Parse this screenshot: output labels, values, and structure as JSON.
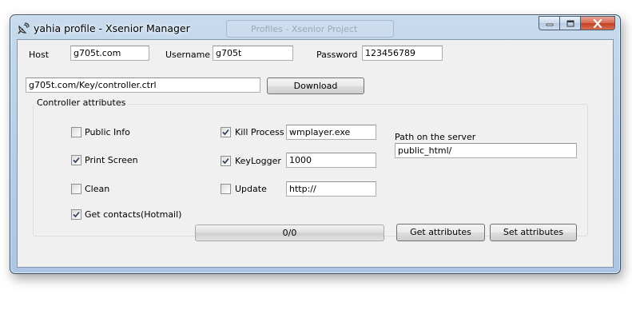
{
  "window": {
    "title": "yahia profile - Xsenior Manager",
    "background_window_title": "Profiles - Xsenior Project"
  },
  "connection": {
    "host_label": "Host",
    "host_value": "g705t.com",
    "username_label": "Username",
    "username_value": "g705t",
    "password_label": "Password",
    "password_value": "123456789"
  },
  "download": {
    "path_value": "g705t.com/Key/controller.ctrl",
    "button_label": "Download"
  },
  "attributes": {
    "group_title": "Controller attributes",
    "public_info": {
      "label": "Public Info",
      "checked": false
    },
    "print_screen": {
      "label": "Print Screen",
      "checked": true
    },
    "clean": {
      "label": "Clean",
      "checked": false
    },
    "get_contacts": {
      "label": "Get contacts(Hotmail)",
      "checked": true
    },
    "kill_process": {
      "label": "Kill Process",
      "checked": true,
      "value": "wmplayer.exe"
    },
    "keylogger": {
      "label": "KeyLogger",
      "checked": true,
      "value": "1000"
    },
    "update": {
      "label": "Update",
      "checked": false,
      "value": "http://"
    },
    "server_path_label": "Path on the server",
    "server_path_value": "public_html/",
    "progress_text": "0/0",
    "progress_fraction": 0,
    "get_button_label": "Get attributes",
    "set_button_label": "Set attributes"
  }
}
